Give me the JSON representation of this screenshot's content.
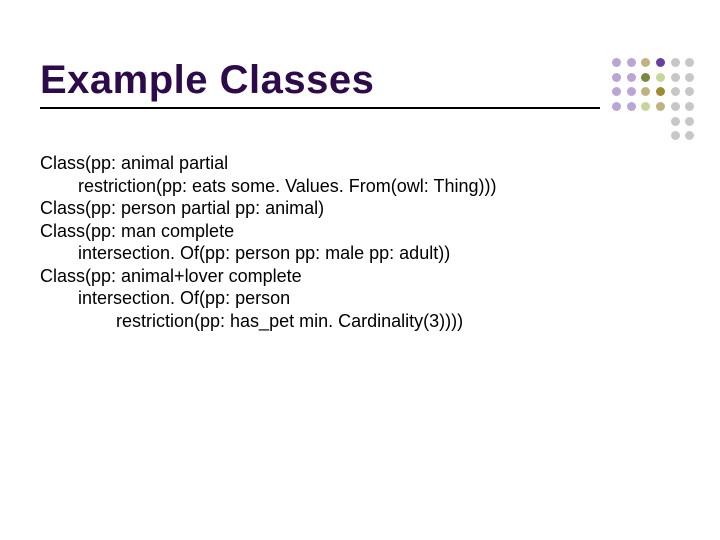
{
  "title": "Example Classes",
  "lines": {
    "l0": "Class(pp: animal partial",
    "l1": "restriction(pp: eats some. Values. From(owl: Thing)))",
    "l2": "Class(pp: person partial pp: animal)",
    "l3": "Class(pp: man complete",
    "l4": "intersection. Of(pp: person pp: male pp: adult))",
    "l5": "Class(pp: animal+lover complete",
    "l6": "intersection. Of(pp: person",
    "l7": "restriction(pp: has_pet min. Cardinality(3))))"
  }
}
